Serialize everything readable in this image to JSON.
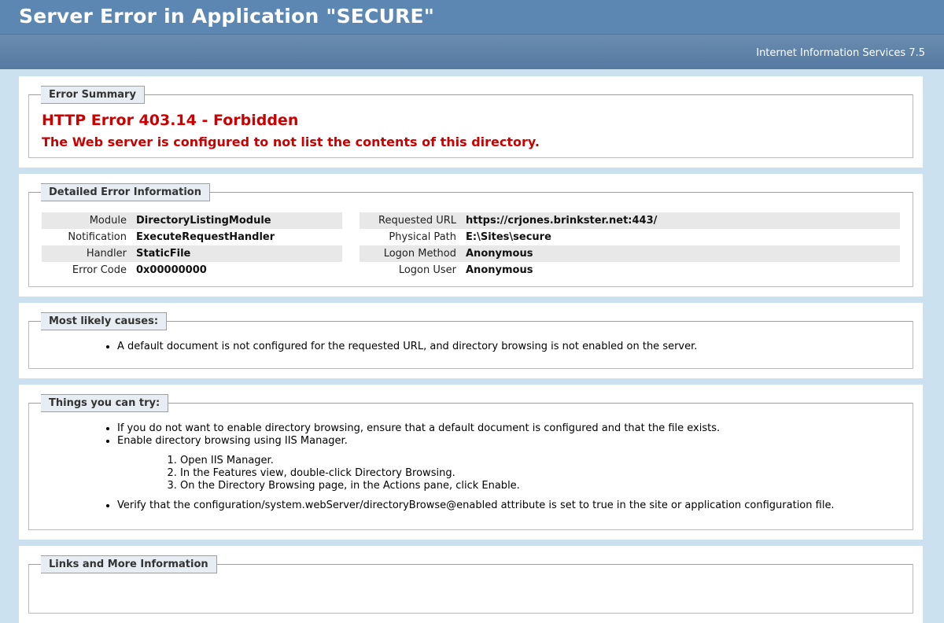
{
  "header": {
    "title": "Server Error in Application \"SECURE\"",
    "server": "Internet Information Services 7.5"
  },
  "summary": {
    "legend": "Error Summary",
    "title": "HTTP Error 403.14 - Forbidden",
    "message": "The Web server is configured to not list the contents of this directory."
  },
  "details": {
    "legend": "Detailed Error Information",
    "left": [
      {
        "key": "Module",
        "value": "DirectoryListingModule"
      },
      {
        "key": "Notification",
        "value": "ExecuteRequestHandler"
      },
      {
        "key": "Handler",
        "value": "StaticFile"
      },
      {
        "key": "Error Code",
        "value": "0x00000000"
      }
    ],
    "right": [
      {
        "key": "Requested URL",
        "value": "https://crjones.brinkster.net:443/"
      },
      {
        "key": "Physical Path",
        "value": "E:\\Sites\\secure"
      },
      {
        "key": "Logon Method",
        "value": "Anonymous"
      },
      {
        "key": "Logon User",
        "value": "Anonymous"
      }
    ]
  },
  "causes": {
    "legend": "Most likely causes:",
    "items": [
      "A default document is not configured for the requested URL, and directory browsing is not enabled on the server."
    ]
  },
  "try": {
    "legend": "Things you can try:",
    "items": [
      "If you do not want to enable directory browsing, ensure that a default document is configured and that the file exists.",
      "Enable directory browsing using IIS Manager.",
      "Verify that the configuration/system.webServer/directoryBrowse@enabled attribute is set to true in the site or application configuration file."
    ],
    "steps": [
      "Open IIS Manager.",
      "In the Features view, double-click Directory Browsing.",
      "On the Directory Browsing page, in the Actions pane, click Enable."
    ]
  },
  "links": {
    "legend": "Links and More Information"
  }
}
